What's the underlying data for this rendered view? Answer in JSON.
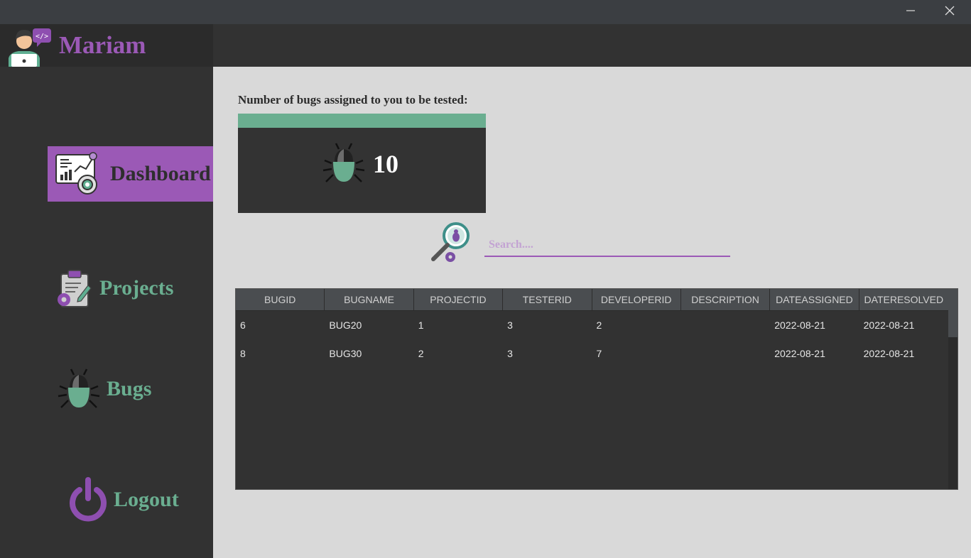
{
  "window": {
    "minimize_icon": "minimize-icon",
    "close_icon": "close-icon"
  },
  "user": {
    "name": "Mariam",
    "avatar_icon": "developer-avatar-icon"
  },
  "nav": {
    "dashboard": {
      "label": "Dashboard",
      "icon": "dashboard-chart-icon",
      "active": true
    },
    "projects": {
      "label": "Projects",
      "icon": "clipboard-gear-icon"
    },
    "bugs": {
      "label": "Bugs",
      "icon": "bug-icon"
    },
    "logout": {
      "label": "Logout",
      "icon": "power-icon"
    }
  },
  "dashboard": {
    "bugs_caption": "Number of bugs assigned to you to be tested:",
    "bugs_count": "10"
  },
  "search": {
    "placeholder": "Search....",
    "value": ""
  },
  "table": {
    "columns": [
      "BUGID",
      "BUGNAME",
      "PROJECTID",
      "TESTERID",
      "DEVELOPERID",
      "DESCRIPTION",
      "DATEASSIGNED",
      "DATERESOLVED"
    ],
    "rows": [
      [
        "6",
        "BUG20",
        "1",
        "3",
        "2",
        "",
        "2022-08-21",
        "2022-08-21"
      ],
      [
        "8",
        "BUG30",
        "2",
        "3",
        "7",
        "",
        "2022-08-21",
        "2022-08-21"
      ]
    ]
  },
  "colors": {
    "accent_purple": "#9b59b6",
    "accent_green": "#6aae90",
    "sidebar_bg": "#323232",
    "content_bg": "#d9d9d9"
  }
}
